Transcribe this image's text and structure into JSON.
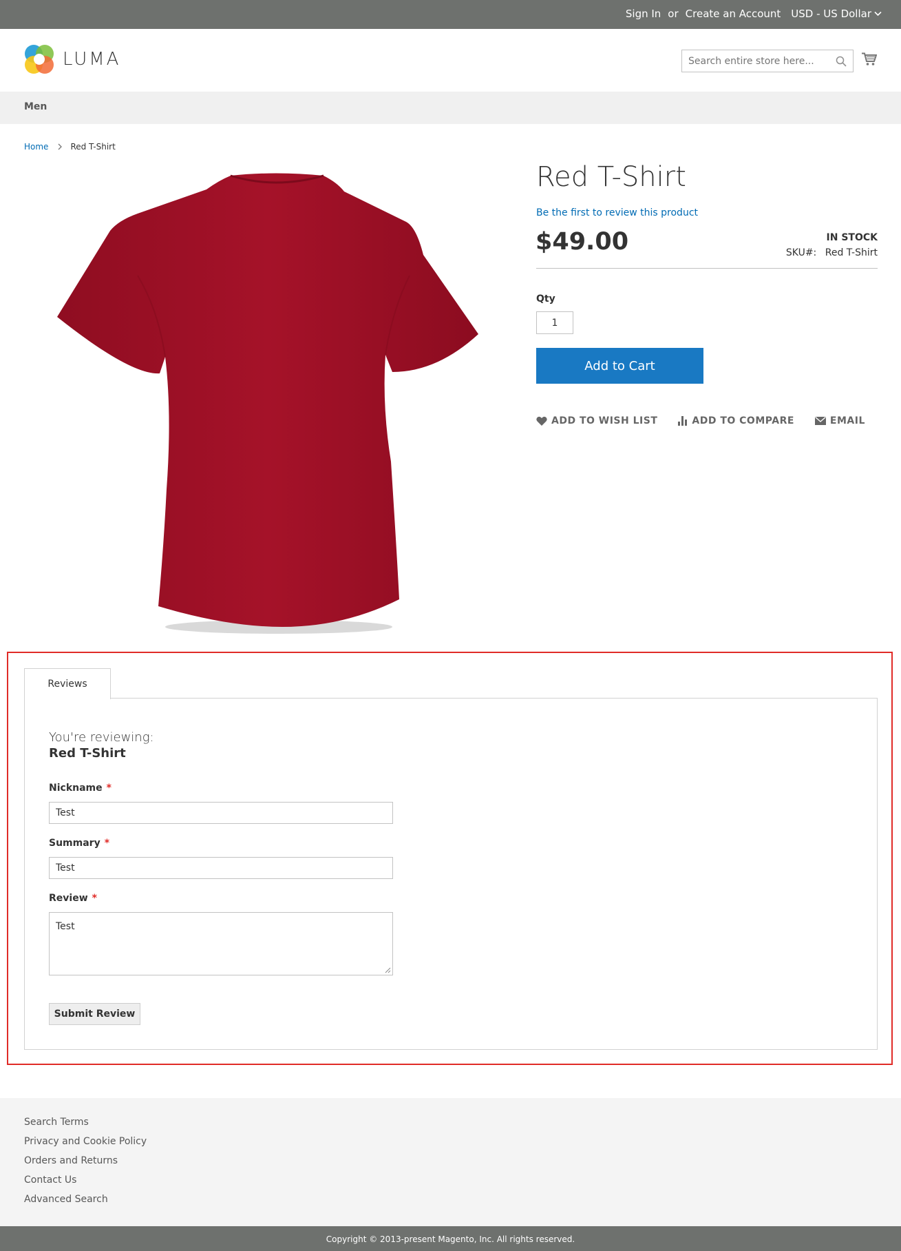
{
  "topbar": {
    "sign_in": "Sign In",
    "or": "or",
    "create_account": "Create an Account",
    "currency": "USD - US Dollar"
  },
  "header": {
    "logo_text": "LUMA",
    "search_placeholder": "Search entire store here..."
  },
  "nav": {
    "items": [
      {
        "label": "Men"
      }
    ]
  },
  "breadcrumb": {
    "home": "Home",
    "current": "Red T-Shirt"
  },
  "product": {
    "title": "Red T-Shirt",
    "review_link": "Be the first to review this product",
    "price": "$49.00",
    "stock": "In stock",
    "sku_label": "SKU#:",
    "sku_value": "Red T-Shirt",
    "qty_label": "Qty",
    "qty_value": "1",
    "add_to_cart": "Add to Cart",
    "actions": {
      "wishlist": "Add to Wish List",
      "compare": "Add to Compare",
      "email": "Email"
    },
    "shirt_color": "#a01027"
  },
  "reviews": {
    "tab_label": "Reviews",
    "reviewing_label": "You're reviewing:",
    "reviewing_product": "Red T-Shirt",
    "nickname_label": "Nickname",
    "nickname_value": "Test",
    "summary_label": "Summary",
    "summary_value": "Test",
    "review_label": "Review",
    "review_value": "Test",
    "required_mark": "*",
    "submit": "Submit Review"
  },
  "footer": {
    "links": [
      "Search Terms",
      "Privacy and Cookie Policy",
      "Orders and Returns",
      "Contact Us",
      "Advanced Search"
    ],
    "copyright": "Copyright © 2013-present Magento, Inc. All rights reserved."
  },
  "colors": {
    "link": "#006bb4",
    "primary_button": "#1979c3",
    "highlight_border": "#e02b27",
    "topbar": "#6e716e"
  }
}
